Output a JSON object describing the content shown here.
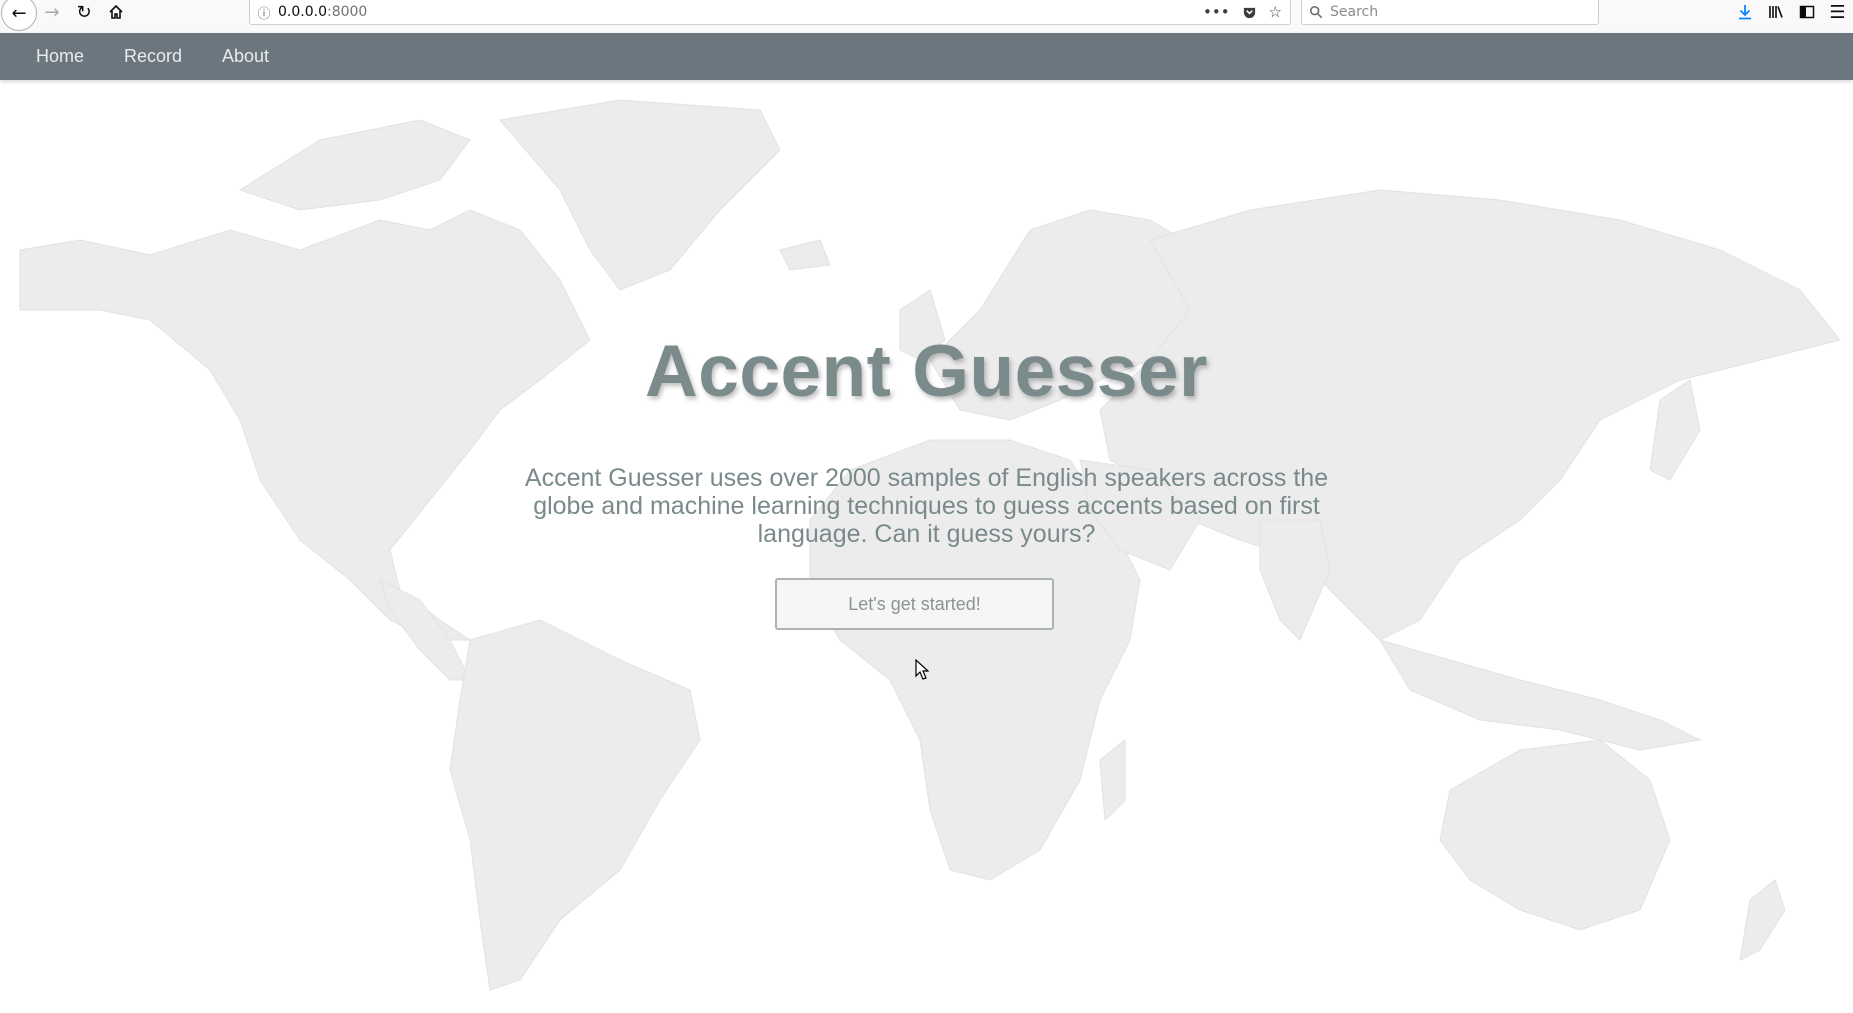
{
  "browser": {
    "url_host": "0.0.0.0",
    "url_port": ":8000",
    "search_placeholder": "Search",
    "icons": {
      "back": "back-arrow-icon",
      "forward": "forward-arrow-icon",
      "reload": "reload-icon",
      "home": "home-icon",
      "info": "info-icon",
      "more": "more-dots-icon",
      "pocket": "pocket-icon",
      "bookmark": "star-icon",
      "search": "search-icon",
      "download": "download-icon",
      "library": "library-icon",
      "sidebar": "sidebar-icon",
      "menu": "hamburger-menu-icon"
    }
  },
  "nav": {
    "items": [
      {
        "label": "Home"
      },
      {
        "label": "Record"
      },
      {
        "label": "About"
      }
    ]
  },
  "hero": {
    "title": "Accent Guesser",
    "description": "Accent Guesser uses over 2000 samples of English speakers across the globe and machine learning techniques to guess accents based on first language. Can it guess yours?",
    "cta_label": "Let's get started!"
  },
  "colors": {
    "navbar": "#6b767e",
    "title": "#7b8b8b",
    "map": "#ececec"
  }
}
